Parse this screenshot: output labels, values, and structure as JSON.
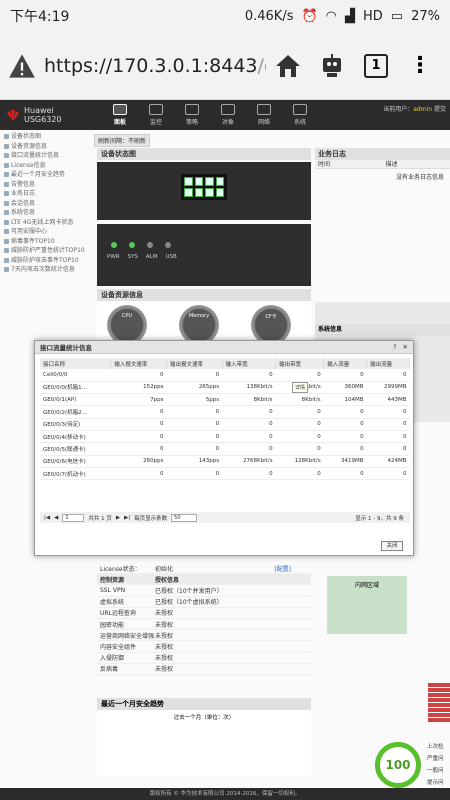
{
  "statusbar": {
    "time": "下午4:19",
    "speed": "0.46K/s",
    "network": "HD",
    "battery": "27%"
  },
  "browser": {
    "url": "https://170.3.0.1:8443",
    "url_dim": "/c",
    "tab_count": "1"
  },
  "header": {
    "brand": "Huawei",
    "model": "USG6320",
    "nav": [
      "面板",
      "监控",
      "策略",
      "对象",
      "网络",
      "系统"
    ],
    "current_user_label": "当前用户：",
    "current_user": "admin",
    "user_extra": "提交"
  },
  "sidebar": {
    "items": [
      "设备状态图",
      "设备资源信息",
      "接口流量统计信息",
      "License信息",
      "最近一个月安全趋势",
      "告警信息",
      "业务日志",
      "会话信息",
      "系统信息",
      "LTE 4G无线上网卡状态",
      "可用安服中心",
      "病毒事件TOP10",
      "威胁防护严重性统计TOP10",
      "威胁防护攻击事件TOP10",
      "7天内攻击次数统计信息"
    ]
  },
  "toolbar": {
    "refresh": "刷新间隔：不刷新"
  },
  "panels": {
    "device_status": "设备状态图",
    "device_resource": "设备资源信息",
    "business_log": "业务日志",
    "time_col": "时间",
    "desc_col": "描述",
    "no_log": "没有业务日志信息",
    "system_info": "系统信息",
    "leds": [
      "PWR",
      "SYS",
      "ALM",
      "USB"
    ],
    "gauges": [
      "CPU",
      "Memory",
      "CF卡"
    ]
  },
  "dialog": {
    "title": "接口流量统计信息",
    "help": "?",
    "close": "✕",
    "headers": [
      "接口名称",
      "输入报文速率",
      "输出报文速率",
      "输入带宽",
      "输出带宽",
      "输入流量",
      "输出流量"
    ],
    "rows": [
      [
        "Cell0/0/0",
        "0",
        "0",
        "0",
        "0",
        "0",
        "0"
      ],
      [
        "GE0/0/0(机箱1…",
        "152pps",
        "265pps",
        "138Kbit/s",
        "280Kbit/s",
        "360MB",
        "2999MB"
      ],
      [
        "GE0/0/1(AP)",
        "7pps",
        "5pps",
        "8Kbit/s",
        "8Kbit/s",
        "104MB",
        "443MB"
      ],
      [
        "GE0/0/2(机箱2…",
        "0",
        "0",
        "0",
        "0",
        "0",
        "0"
      ],
      [
        "GE0/0/3(待定)",
        "0",
        "0",
        "0",
        "0",
        "0",
        "0"
      ],
      [
        "GE0/0/4(移动卡)",
        "0",
        "0",
        "0",
        "0",
        "0",
        "0"
      ],
      [
        "GE0/0/5(联通卡)",
        "0",
        "0",
        "0",
        "0",
        "0",
        "0"
      ],
      [
        "GE0/0/6(电信卡)",
        "260pps",
        "143pps",
        "2768Kbit/s",
        "128Kbit/s",
        "3419MB",
        "424MB"
      ],
      [
        "GE0/0/7(机动卡)",
        "0",
        "0",
        "0",
        "0",
        "0",
        "0"
      ]
    ],
    "tooltip": "详情",
    "pager": {
      "page": "1",
      "total_pages": "共共 1 页",
      "per_page_label": "每页显示条数",
      "per_page": "50",
      "summary": "显示 1 - 9，共 9 条"
    },
    "close_button": "关闭"
  },
  "license": {
    "status_label": "License状态：",
    "status": "初始化",
    "config_link": "[配置]",
    "col1": "控制资源",
    "col2": "授权信息",
    "rows": [
      [
        "SSL VPN",
        "已授权（10个并发用户）"
      ],
      [
        "虚拟系统",
        "已授权（10个虚拟系统）"
      ],
      [
        "URL远程查询",
        "未授权"
      ],
      [
        "园密功能",
        "未授权"
      ],
      [
        "运营商网络安全增强",
        "未授权"
      ],
      [
        "内容安全组件",
        "未授权"
      ],
      [
        "入侵防御",
        "未授权"
      ],
      [
        "反病毒",
        "未授权"
      ]
    ]
  },
  "trend": {
    "title": "最近一个月安全趋势",
    "subtitle": "过去一个月（单位：次）"
  },
  "inner_zone": "内网区域",
  "score": "100",
  "right_texts": [
    "上次检",
    "严重问",
    "一般问",
    "提示问"
  ],
  "footer": "版权所有 © 华为技术有限公司 2014-2016，保留一切权利。"
}
